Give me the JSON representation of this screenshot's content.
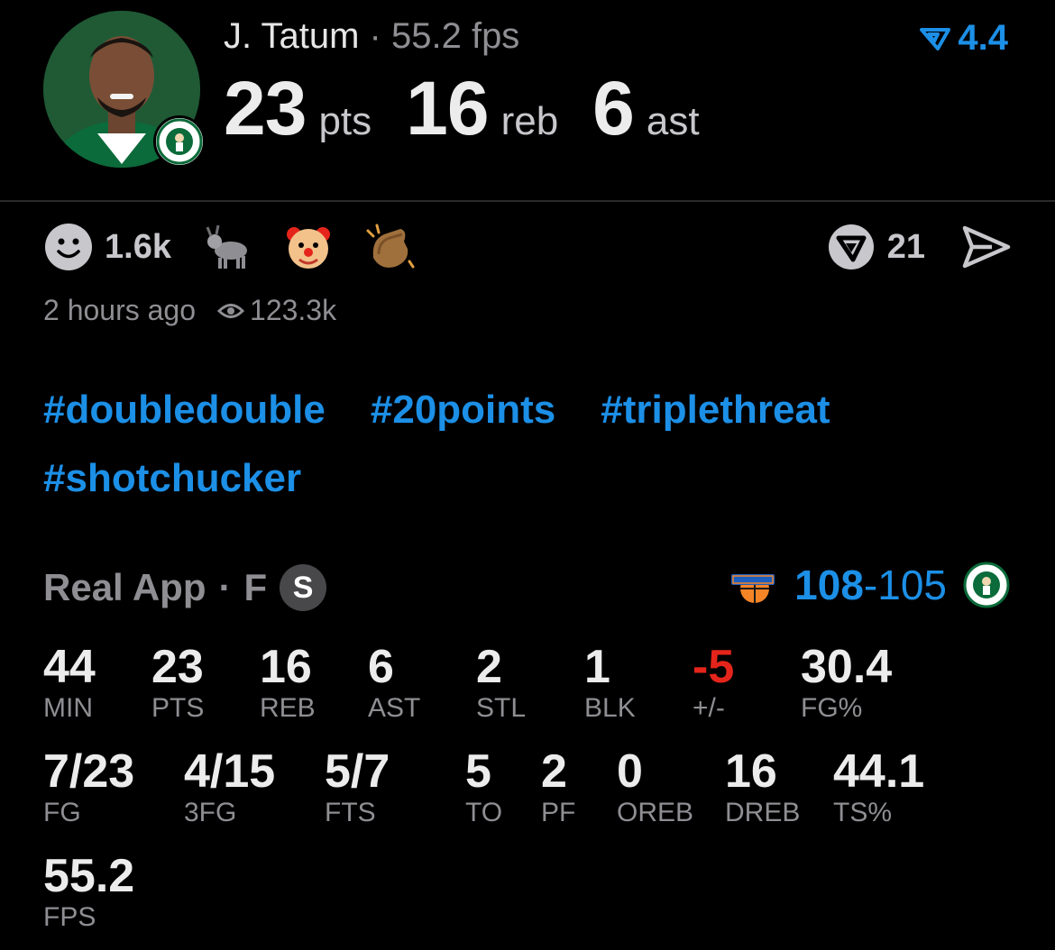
{
  "header": {
    "player_name": "J. Tatum",
    "separator": " · ",
    "fps_text": "55.2 fps",
    "rating": "4.4",
    "pts": "23",
    "pts_unit": "pts",
    "reb": "16",
    "reb_unit": "reb",
    "ast": "6",
    "ast_unit": "ast"
  },
  "reactions": {
    "count": "1.6k",
    "emojis": [
      "goat",
      "clown",
      "clap"
    ],
    "vote_count": "21"
  },
  "meta": {
    "time": "2 hours ago",
    "views": "123.3k"
  },
  "tags": [
    "#doubledouble",
    "#20points",
    "#triplethreat",
    "#shotchucker"
  ],
  "game": {
    "source": "Real App",
    "dot": "·",
    "position": "F",
    "badge": "S",
    "score_a": "108",
    "score_sep": "-",
    "score_b": "105",
    "team_a_logo": "knicks-logo",
    "team_b_logo": "celtics-logo"
  },
  "stats": [
    {
      "value": "44",
      "label": "MIN"
    },
    {
      "value": "23",
      "label": "PTS"
    },
    {
      "value": "16",
      "label": "REB"
    },
    {
      "value": "6",
      "label": "AST"
    },
    {
      "value": "2",
      "label": "STL"
    },
    {
      "value": "1",
      "label": "BLK"
    },
    {
      "value": "-5",
      "label": "+/-"
    },
    {
      "value": "30.4",
      "label": "FG%"
    },
    {
      "value": "7/23",
      "label": "FG"
    },
    {
      "value": "4/15",
      "label": "3FG"
    },
    {
      "value": "5/7",
      "label": "FTS"
    },
    {
      "value": "5",
      "label": "TO"
    },
    {
      "value": "2",
      "label": "PF"
    },
    {
      "value": "0",
      "label": "OREB"
    },
    {
      "value": "16",
      "label": "DREB"
    },
    {
      "value": "44.1",
      "label": "TS%"
    },
    {
      "value": "55.2",
      "label": "FPS"
    }
  ],
  "colors": {
    "accent": "#1c8fe6",
    "negative": "#e5251b",
    "muted": "#8e8e93",
    "background": "#000000"
  }
}
